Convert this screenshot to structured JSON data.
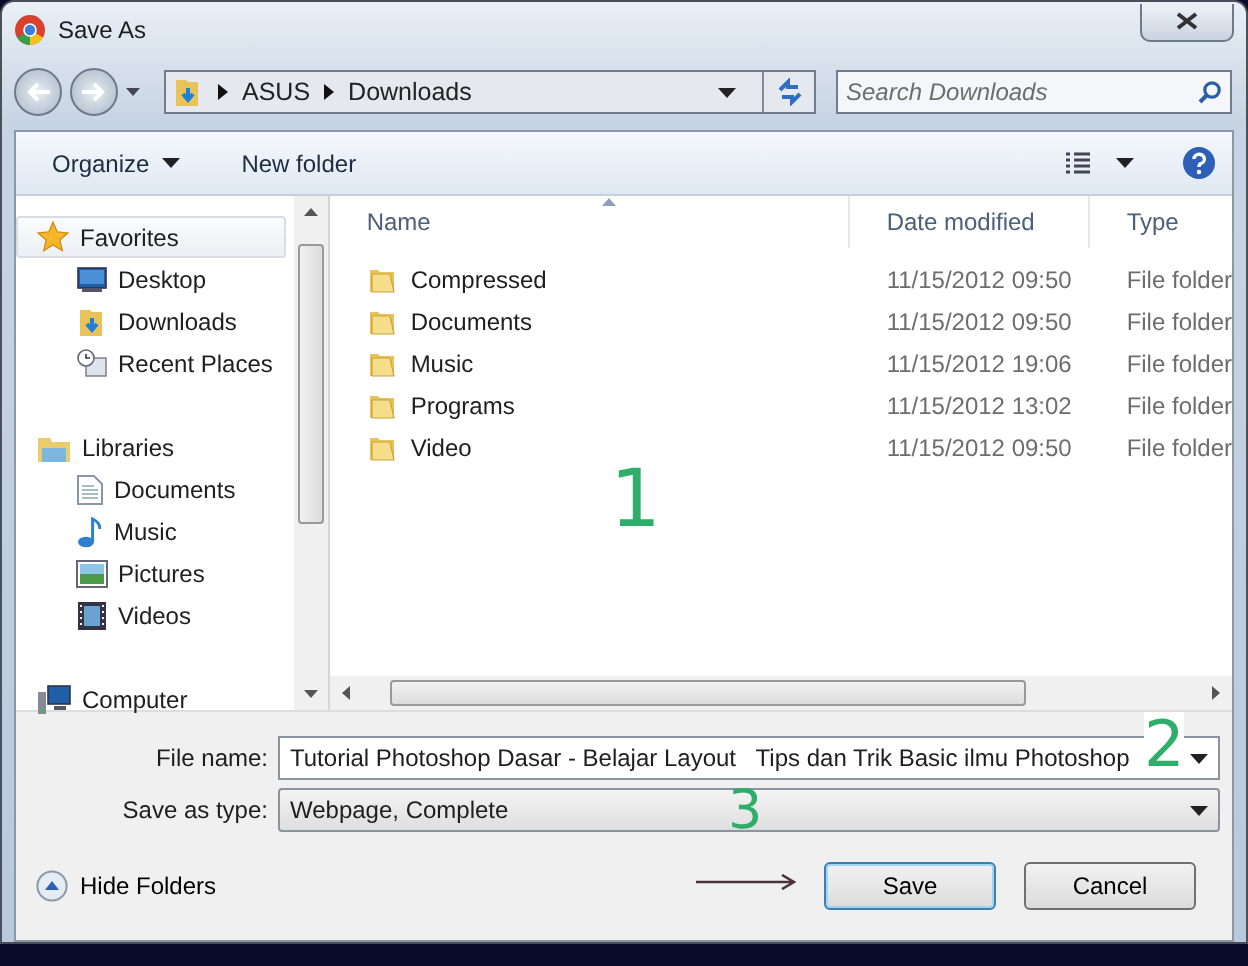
{
  "window": {
    "title": "Save As"
  },
  "address": {
    "path": [
      "ASUS",
      "Downloads"
    ],
    "search_placeholder": "Search Downloads"
  },
  "toolbar": {
    "organize": "Organize",
    "new_folder": "New folder"
  },
  "nav": [
    {
      "label": "Favorites",
      "selected": true,
      "children": [
        {
          "label": "Desktop",
          "selected": false
        },
        {
          "label": "Downloads",
          "selected": false
        },
        {
          "label": "Recent Places",
          "selected": false
        }
      ]
    },
    {
      "label": "Libraries",
      "selected": false,
      "children": [
        {
          "label": "Documents",
          "selected": false
        },
        {
          "label": "Music",
          "selected": false
        },
        {
          "label": "Pictures",
          "selected": false
        },
        {
          "label": "Videos",
          "selected": false
        }
      ]
    },
    {
      "label": "Computer",
      "selected": false
    }
  ],
  "files": {
    "columns": [
      "Name",
      "Date modified",
      "Type"
    ],
    "rows": [
      {
        "name": "Compressed",
        "date": "11/15/2012 09:50",
        "type": "File folder"
      },
      {
        "name": "Documents",
        "date": "11/15/2012 09:50",
        "type": "File folder"
      },
      {
        "name": "Music",
        "date": "11/15/2012 19:06",
        "type": "File folder"
      },
      {
        "name": "Programs",
        "date": "11/15/2012 13:02",
        "type": "File folder"
      },
      {
        "name": "Video",
        "date": "11/15/2012 09:50",
        "type": "File folder"
      }
    ]
  },
  "form": {
    "file_name": {
      "label": "File name:",
      "value": "Tutorial Photoshop Dasar - Belajar Layout   Tips dan Trik Basic ilmu Photoshop"
    },
    "save_type": {
      "label": "Save as type:",
      "value": "Webpage, Complete"
    }
  },
  "hide_folders": "Hide Folders",
  "buttons": [
    {
      "label": "Save",
      "default": true
    },
    {
      "label": "Cancel",
      "default": false
    }
  ],
  "annotations": [
    "1",
    "2",
    "3"
  ]
}
